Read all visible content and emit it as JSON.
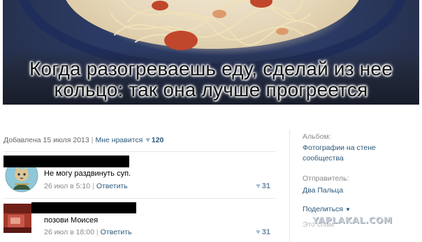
{
  "photo": {
    "caption_line1": "Когда разогреваешь еду, сделай из нее",
    "caption_line2": "кольцо: так она лучше прогреется"
  },
  "meta": {
    "added": "Добавлена 15 июля 2013",
    "like_label": "Мне нравится",
    "like_count": "120"
  },
  "comments": [
    {
      "text": "Не могу раздвинуть суп.",
      "time": "26 июл в 5:10",
      "reply": "Ответить",
      "likes": "31"
    },
    {
      "text": "позови Моисея",
      "time": "26 июл в 18:00",
      "reply": "Ответить",
      "likes": "31"
    }
  ],
  "sidebar": {
    "album_label": "Альбом:",
    "album_value_line1": "Фотографии на стене",
    "album_value_line2": "сообщества",
    "sender_label": "Отправитель:",
    "sender_value": "Два Пальца",
    "share_label": "Поделиться",
    "spam_label": "Это спам"
  },
  "watermark": "YAPLAKAL.COM",
  "icons": {
    "heart": "heart-icon",
    "caret": "caret-down-icon"
  },
  "colors": {
    "link": "#2b587a",
    "muted": "#888888",
    "heart": "#9db3cd"
  }
}
